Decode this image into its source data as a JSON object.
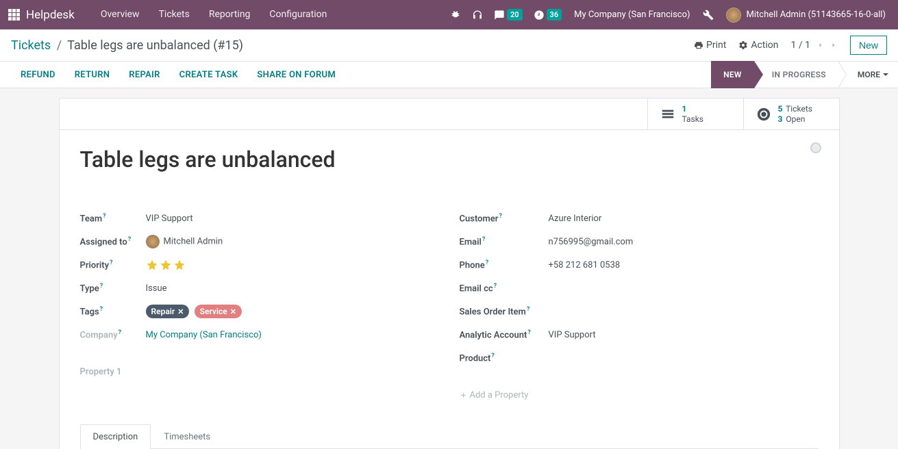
{
  "header": {
    "brand": "Helpdesk",
    "nav": [
      {
        "label": "Overview"
      },
      {
        "label": "Tickets"
      },
      {
        "label": "Reporting"
      },
      {
        "label": "Configuration"
      }
    ],
    "messages_badge": "20",
    "activities_badge": "36",
    "company_name": "My Company (San Francisco)",
    "user_name": "Mitchell Admin (51143665-16-0-all)"
  },
  "control": {
    "breadcrumb_root": "Tickets",
    "breadcrumb_current": "Table legs are unbalanced (#15)",
    "print": "Print",
    "action": "Action",
    "pager": "1 / 1",
    "new": "New"
  },
  "statusbar": {
    "buttons": [
      {
        "label": "REFUND"
      },
      {
        "label": "RETURN"
      },
      {
        "label": "REPAIR"
      },
      {
        "label": "CREATE TASK"
      },
      {
        "label": "SHARE ON FORUM"
      }
    ],
    "stages": {
      "new": "NEW",
      "in_progress": "IN PROGRESS",
      "more": "MORE"
    }
  },
  "stats": {
    "tasks_count": "1",
    "tasks_label": "Tasks",
    "tickets_count": "5",
    "tickets_label": "Tickets",
    "open_count": "3",
    "open_label": "Open"
  },
  "ticket": {
    "title": "Table legs are unbalanced",
    "team": {
      "label": "Team",
      "value": "VIP Support"
    },
    "assigned": {
      "label": "Assigned to",
      "value": "Mitchell Admin"
    },
    "priority": {
      "label": "Priority"
    },
    "type": {
      "label": "Type",
      "value": "Issue"
    },
    "tags": {
      "label": "Tags",
      "repair": "Repair",
      "service": "Service"
    },
    "company": {
      "label": "Company",
      "value": "My Company (San Francisco)"
    },
    "customer": {
      "label": "Customer",
      "value": "Azure Interior"
    },
    "email": {
      "label": "Email",
      "value": "n756995@gmail.com"
    },
    "phone": {
      "label": "Phone",
      "value": "+58 212 681 0538"
    },
    "email_cc": {
      "label": "Email cc"
    },
    "sales_order_item": {
      "label": "Sales Order Item"
    },
    "analytic": {
      "label": "Analytic Account",
      "value": "VIP Support"
    },
    "product": {
      "label": "Product"
    },
    "property1": "Property 1",
    "add_property": "Add a Property"
  },
  "tabs": {
    "description": "Description",
    "timesheets": "Timesheets"
  }
}
